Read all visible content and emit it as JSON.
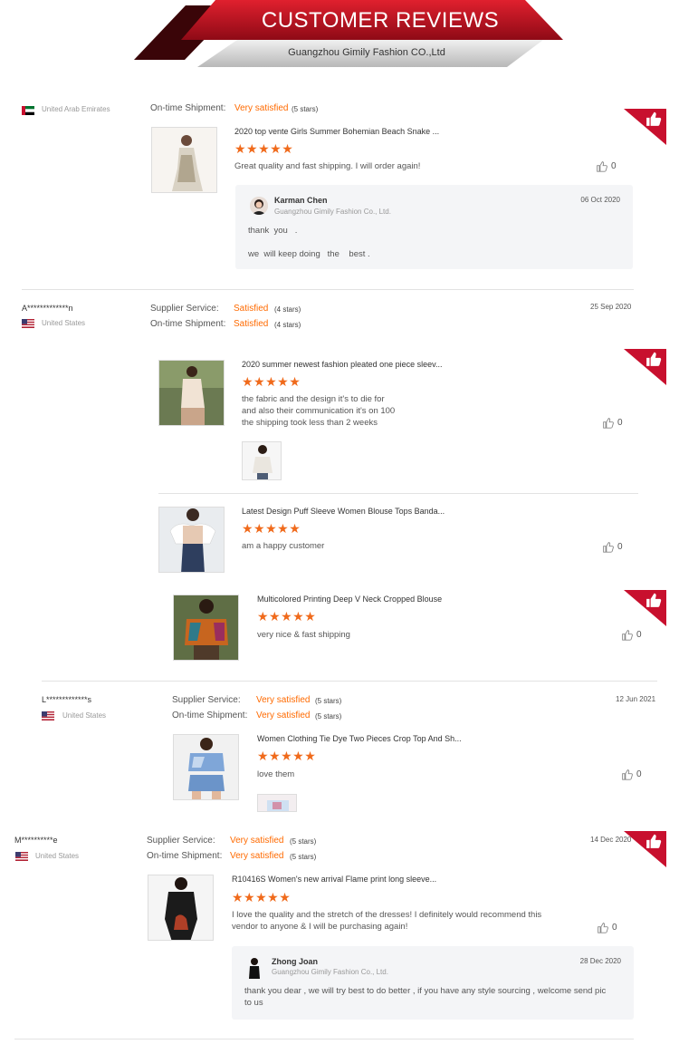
{
  "banner": {
    "title": "CUSTOMER REVIEWS",
    "subtitle": "Guangzhou Gimily Fashion CO.,Ltd"
  },
  "labels": {
    "supplier_service": "Supplier Service:",
    "ontime_shipment": "On-time Shipment:"
  },
  "review0": {
    "country": "United Arab Emirates",
    "ontime_label": "On-time Shipment:",
    "ontime_value": "Very satisfied",
    "ontime_stars": "(5 stars)",
    "product": "2020 top vente Girls Summer Bohemian Beach Snake ...",
    "rating": 5,
    "stars": "★★★★★",
    "text": "Great quality and fast shipping. I will order again!",
    "likes": "0",
    "reply": {
      "name": "Karman Chen",
      "company": "Guangzhou Gimily Fashion Co., Ltd.",
      "date": "06 Oct 2020",
      "line1": "thank  you   .",
      "line2": "we  will keep doing   the    best ."
    }
  },
  "review1": {
    "user": "A*************n",
    "country": "United States",
    "date": "25 Sep 2020",
    "supplier_value": "Satisfied",
    "supplier_stars": "(4 stars)",
    "ontime_value": "Satisfied",
    "ontime_stars": "(4 stars)",
    "items": [
      {
        "product": "2020 summer newest fashion pleated one piece sleev...",
        "rating": 5,
        "stars": "★★★★★",
        "text_lines": [
          "the fabric and the design it's to die for",
          "and also their communication it's on 100",
          "the shipping took less than 2 weeks"
        ],
        "likes": "0"
      },
      {
        "product": "Latest Design Puff Sleeve Women Blouse Tops Banda...",
        "rating": 5,
        "stars": "★★★★★",
        "text": "am a happy customer",
        "likes": "0"
      },
      {
        "product": "Multicolored Printing Deep V Neck Cropped Blouse",
        "rating": 5,
        "stars": "★★★★★",
        "text": "very nice & fast shipping",
        "likes": "0"
      }
    ]
  },
  "review2": {
    "user": "L*************s",
    "country": "United States",
    "date": "12 Jun 2021",
    "supplier_value": "Very satisfied",
    "supplier_stars": "(5 stars)",
    "ontime_value": "Very satisfied",
    "ontime_stars": "(5 stars)",
    "product": "Women Clothing Tie Dye Two Pieces Crop Top And Sh...",
    "rating": 5,
    "stars": "★★★★★",
    "text": "love them",
    "likes": "0"
  },
  "review3": {
    "user": "M**********e",
    "country": "United States",
    "date": "14 Dec 2020",
    "supplier_value": "Very satisfied",
    "supplier_stars": "(5 stars)",
    "ontime_value": "Very satisfied",
    "ontime_stars": "(5 stars)",
    "product": "R10416S Women's new arrival Flame print long sleeve...",
    "rating": 5,
    "stars": "★★★★★",
    "text_lines": [
      "I love the quality and the stretch of the dresses! I definitely would recommend this",
      "vendor to anyone & I will be purchasing again!"
    ],
    "likes": "0",
    "reply": {
      "name": "Zhong Joan",
      "company": "Guangzhou Gimily Fashion Co., Ltd.",
      "date": "28 Dec 2020",
      "line1": "thank you dear , we will try best to do better , if you have any style sourcing , welcome send pic",
      "line2": "to us"
    }
  },
  "colors": {
    "accent_red": "#c8102e",
    "star_orange": "#f06a1b",
    "value_orange": "#ff6a00"
  },
  "icons": {
    "like": "thumbs-up-icon",
    "corner": "thumbs-up-badge-icon",
    "flag_us": "us-flag-icon",
    "flag_ae": "uae-flag-icon"
  }
}
